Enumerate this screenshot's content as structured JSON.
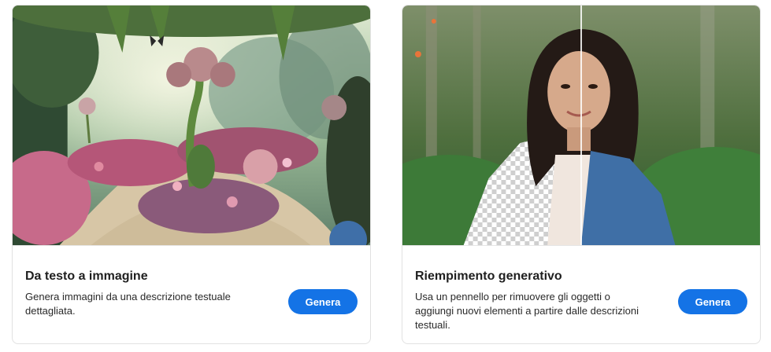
{
  "cards": [
    {
      "title": "Da testo a immagine",
      "description": "Genera immagini da una descrizione testuale dettagliata.",
      "button_label": "Genera"
    },
    {
      "title": "Riempimento generativo",
      "description": "Usa un pennello per rimuovere gli oggetti o aggiungi nuovi elementi a partire dalle descrizioni testuali.",
      "button_label": "Genera"
    }
  ],
  "colors": {
    "accent": "#1473e6",
    "title_text": "#1f1f1f",
    "body_text": "#292929",
    "card_border": "#e1e1e1"
  }
}
